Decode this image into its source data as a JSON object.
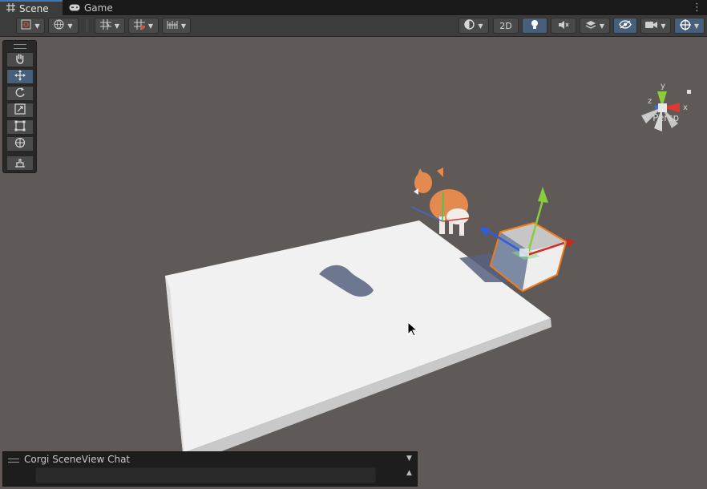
{
  "tabs": [
    {
      "label": "Scene",
      "icon": "grid-hash-icon",
      "active": true
    },
    {
      "label": "Game",
      "icon": "gamepad-icon",
      "active": false
    }
  ],
  "toolbar": {
    "mode_2d_label": "2D",
    "left_group": [
      "draw-mode-icon",
      "global-local-icon",
      "grid-snap-icon",
      "increment-snap-icon",
      "ruler-snap-icon"
    ],
    "right_group": [
      "shading-sphere-icon",
      "2d-toggle",
      "lighting-bulb-icon",
      "audio-mute-icon",
      "effects-layers-icon",
      "visibility-hidden-icon",
      "camera-icon",
      "gizmos-icon"
    ]
  },
  "tools": [
    {
      "name": "view-tool",
      "icon": "hand-icon",
      "active": false
    },
    {
      "name": "move-tool",
      "icon": "move-arrows-icon",
      "active": true
    },
    {
      "name": "rotate-tool",
      "icon": "rotate-icon",
      "active": false
    },
    {
      "name": "scale-tool",
      "icon": "scale-icon",
      "active": false
    },
    {
      "name": "rect-tool",
      "icon": "rect-icon",
      "active": false
    },
    {
      "name": "transform-tool",
      "icon": "transform-icon",
      "active": false
    },
    {
      "name": "custom-tool",
      "icon": "custom-editor-icon",
      "active": false
    }
  ],
  "orientation_gizmo": {
    "axis_y": "y",
    "axis_x": "x",
    "axis_z": "z",
    "projection_label": "Persp",
    "colors": {
      "x": "#db3b2f",
      "y": "#8bcc3c",
      "z": "#3a6fd8"
    }
  },
  "scene_objects": [
    "ground-plane",
    "corgi-model",
    "selected-cube",
    "move-gizmo"
  ],
  "chat_panel": {
    "title": "Corgi SceneView Chat",
    "input_value": "",
    "input_placeholder": ""
  },
  "colors": {
    "viewport_background": "#5f5a57",
    "selection_outline": "#f07b1c",
    "active_tool": "#46607c"
  }
}
